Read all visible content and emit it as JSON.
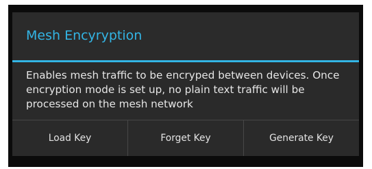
{
  "dialog": {
    "title": "Mesh Encyryption",
    "message": "Enables mesh traffic to be encryped between devices. Once encryption mode is set up, no plain text traffic will be processed on the mesh network",
    "buttons": {
      "load_key": "Load Key",
      "forget_key": "Forget Key",
      "generate_key": "Generate Key"
    }
  },
  "colors": {
    "accent": "#33b5e5",
    "dialog_background": "#2a2a2a",
    "text": "#e6e6e6"
  }
}
